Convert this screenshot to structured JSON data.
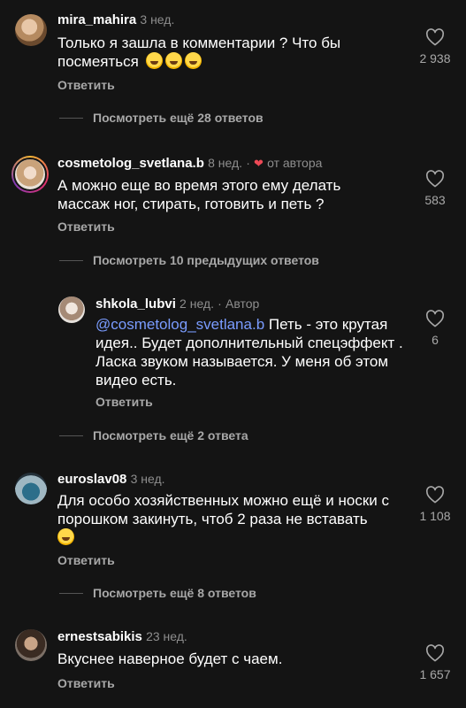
{
  "comments": [
    {
      "username": "mira_mahira",
      "time": "3 нед.",
      "text": "Только я зашла в комментарии ? Что бы посмеяться",
      "emoji_count": 3,
      "likes": "2 938",
      "reply_label": "Ответить",
      "more_replies": "Посмотреть ещё 28 ответов"
    },
    {
      "username": "cosmetolog_svetlana.b",
      "time": "8 нед.",
      "separator": "·",
      "author_like_label": "от автора",
      "text": "А можно еще во время этого ему делать массаж ног, стирать, готовить и петь ?",
      "likes": "583",
      "reply_label": "Ответить",
      "previous_replies": "Посмотреть 10 предыдущих ответов",
      "replies": [
        {
          "username": "shkola_lubvi",
          "time": "2 нед.",
          "separator": "·",
          "author_badge": "Автор",
          "mention": "@cosmetolog_svetlana.b",
          "text": " Петь - это крутая идея.. Будет дополнительный спецэффект . Ласка звуком называется. У меня об этом видео есть.",
          "likes": "6",
          "reply_label": "Ответить"
        }
      ],
      "more_replies": "Посмотреть ещё 2 ответа"
    },
    {
      "username": "euroslav08",
      "time": "3 нед.",
      "text": "Для особо хозяйственных можно ещё и носки с порошком закинуть, чтоб 2 раза не вставать",
      "emoji_count": 1,
      "likes": "1 108",
      "reply_label": "Ответить",
      "more_replies": "Посмотреть ещё 8 ответов"
    },
    {
      "username": "ernestsabikis",
      "time": "23 нед.",
      "text": "Вкуснее наверное будет с чаем.",
      "likes": "1 657",
      "reply_label": "Ответить"
    }
  ],
  "colors": {
    "background": "#141414",
    "text": "#ffffff",
    "muted": "#a8a8a8",
    "mention": "#7a9cff",
    "author_heart": "#ed4956"
  },
  "icons": {
    "like": "heart-outline-icon",
    "author_like": "heart-filled-icon",
    "emoji": "face-with-tears-of-joy-icon"
  }
}
